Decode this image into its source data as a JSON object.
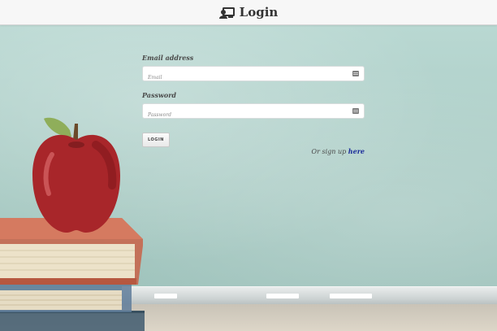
{
  "header": {
    "title": "Login",
    "icon": "user-card-icon"
  },
  "form": {
    "email": {
      "label": "Email address",
      "placeholder": "Email",
      "value": "",
      "icon": "id-card-icon"
    },
    "password": {
      "label": "Password",
      "placeholder": "Password",
      "value": "",
      "icon": "id-card-icon"
    },
    "submit_label": "LOGIN"
  },
  "signup": {
    "prefix": "Or sign up",
    "link_text": "here"
  },
  "colors": {
    "header_bg": "#f7f7f7",
    "chalkboard": "#b3d2cc",
    "link": "#1a2a9a"
  }
}
